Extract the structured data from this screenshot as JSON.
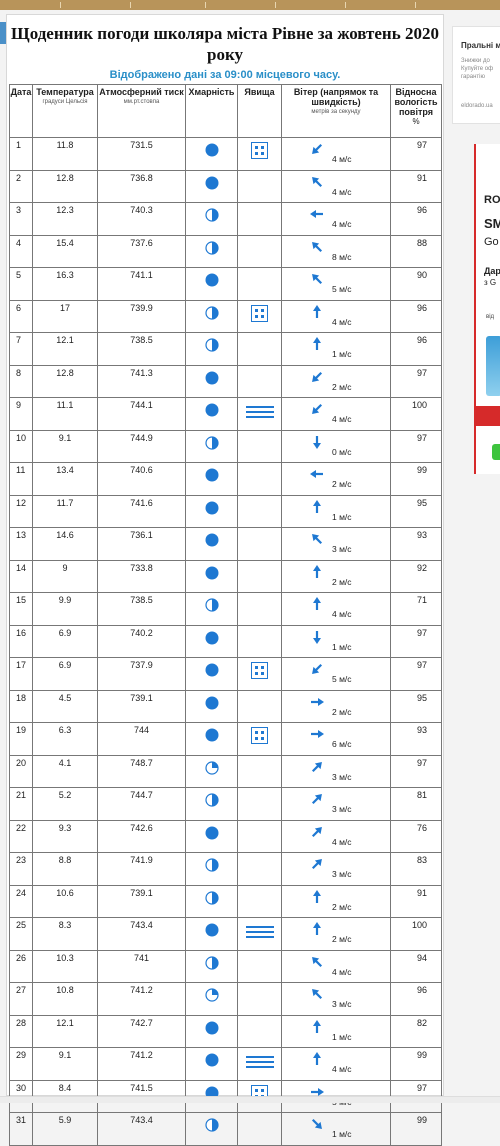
{
  "title": "Щоденник погоди школяра міста Рівне за жовтень 2020 року",
  "subtitle": "Відображено дані за 09:00 місцевого часу.",
  "headers": {
    "date": "Дата",
    "temp": "Температура",
    "temp_unit": "градуси Цельсія",
    "pressure": "Атмосферний тиск",
    "pressure_unit": "мм.рт.стовпа",
    "cloud": "Хмарність",
    "phenomena": "Явища",
    "wind": "Вітер (напрямок та швидкість)",
    "wind_unit": "метрів за секунду",
    "humidity": "Відносна вологість повітря",
    "humidity_unit": "%"
  },
  "rows": [
    {
      "date": "1",
      "temp": "11.8",
      "pressure": "731.5",
      "cloud": "full",
      "phen": "snow-grains",
      "dir": "sw",
      "speed": "4 м/с",
      "hum": "97"
    },
    {
      "date": "2",
      "temp": "12.8",
      "pressure": "736.8",
      "cloud": "full",
      "phen": "",
      "dir": "nw",
      "speed": "4 м/с",
      "hum": "91"
    },
    {
      "date": "3",
      "temp": "12.3",
      "pressure": "740.3",
      "cloud": "half",
      "phen": "",
      "dir": "w",
      "speed": "4 м/с",
      "hum": "96"
    },
    {
      "date": "4",
      "temp": "15.4",
      "pressure": "737.6",
      "cloud": "half",
      "phen": "",
      "dir": "nw",
      "speed": "8 м/с",
      "hum": "88"
    },
    {
      "date": "5",
      "temp": "16.3",
      "pressure": "741.1",
      "cloud": "full",
      "phen": "",
      "dir": "nw",
      "speed": "5 м/с",
      "hum": "90"
    },
    {
      "date": "6",
      "temp": "17",
      "pressure": "739.9",
      "cloud": "half",
      "phen": "snow-grains",
      "dir": "n",
      "speed": "4 м/с",
      "hum": "96"
    },
    {
      "date": "7",
      "temp": "12.1",
      "pressure": "738.5",
      "cloud": "half",
      "phen": "",
      "dir": "n",
      "speed": "1 м/с",
      "hum": "96"
    },
    {
      "date": "8",
      "temp": "12.8",
      "pressure": "741.3",
      "cloud": "full",
      "phen": "",
      "dir": "sw",
      "speed": "2 м/с",
      "hum": "97"
    },
    {
      "date": "9",
      "temp": "11.1",
      "pressure": "744.1",
      "cloud": "full",
      "phen": "fog",
      "dir": "sw",
      "speed": "4 м/с",
      "hum": "100"
    },
    {
      "date": "10",
      "temp": "9.1",
      "pressure": "744.9",
      "cloud": "half",
      "phen": "",
      "dir": "s",
      "speed": "0 м/с",
      "hum": "97"
    },
    {
      "date": "11",
      "temp": "13.4",
      "pressure": "740.6",
      "cloud": "full",
      "phen": "",
      "dir": "w",
      "speed": "2 м/с",
      "hum": "99"
    },
    {
      "date": "12",
      "temp": "11.7",
      "pressure": "741.6",
      "cloud": "full",
      "phen": "",
      "dir": "n",
      "speed": "1 м/с",
      "hum": "95"
    },
    {
      "date": "13",
      "temp": "14.6",
      "pressure": "736.1",
      "cloud": "full",
      "phen": "",
      "dir": "nw",
      "speed": "3 м/с",
      "hum": "93"
    },
    {
      "date": "14",
      "temp": "9",
      "pressure": "733.8",
      "cloud": "full",
      "phen": "",
      "dir": "n",
      "speed": "2 м/с",
      "hum": "92"
    },
    {
      "date": "15",
      "temp": "9.9",
      "pressure": "738.5",
      "cloud": "half",
      "phen": "",
      "dir": "n",
      "speed": "4 м/с",
      "hum": "71"
    },
    {
      "date": "16",
      "temp": "6.9",
      "pressure": "740.2",
      "cloud": "full",
      "phen": "",
      "dir": "s",
      "speed": "1 м/с",
      "hum": "97"
    },
    {
      "date": "17",
      "temp": "6.9",
      "pressure": "737.9",
      "cloud": "full",
      "phen": "snow-grains",
      "dir": "sw",
      "speed": "5 м/с",
      "hum": "97"
    },
    {
      "date": "18",
      "temp": "4.5",
      "pressure": "739.1",
      "cloud": "full",
      "phen": "",
      "dir": "e",
      "speed": "2 м/с",
      "hum": "95"
    },
    {
      "date": "19",
      "temp": "6.3",
      "pressure": "744",
      "cloud": "full",
      "phen": "snow-grains",
      "dir": "e",
      "speed": "6 м/с",
      "hum": "93"
    },
    {
      "date": "20",
      "temp": "4.1",
      "pressure": "748.7",
      "cloud": "quarter",
      "phen": "",
      "dir": "ne",
      "speed": "3 м/с",
      "hum": "97"
    },
    {
      "date": "21",
      "temp": "5.2",
      "pressure": "744.7",
      "cloud": "half",
      "phen": "",
      "dir": "ne",
      "speed": "3 м/с",
      "hum": "81"
    },
    {
      "date": "22",
      "temp": "9.3",
      "pressure": "742.6",
      "cloud": "full",
      "phen": "",
      "dir": "ne",
      "speed": "4 м/с",
      "hum": "76"
    },
    {
      "date": "23",
      "temp": "8.8",
      "pressure": "741.9",
      "cloud": "half",
      "phen": "",
      "dir": "ne",
      "speed": "3 м/с",
      "hum": "83"
    },
    {
      "date": "24",
      "temp": "10.6",
      "pressure": "739.1",
      "cloud": "half",
      "phen": "",
      "dir": "n",
      "speed": "2 м/с",
      "hum": "91"
    },
    {
      "date": "25",
      "temp": "8.3",
      "pressure": "743.4",
      "cloud": "full",
      "phen": "fog",
      "dir": "n",
      "speed": "2 м/с",
      "hum": "100"
    },
    {
      "date": "26",
      "temp": "10.3",
      "pressure": "741",
      "cloud": "half",
      "phen": "",
      "dir": "nw",
      "speed": "4 м/с",
      "hum": "94"
    },
    {
      "date": "27",
      "temp": "10.8",
      "pressure": "741.2",
      "cloud": "quarter",
      "phen": "",
      "dir": "nw",
      "speed": "3 м/с",
      "hum": "96"
    },
    {
      "date": "28",
      "temp": "12.1",
      "pressure": "742.7",
      "cloud": "full",
      "phen": "",
      "dir": "n",
      "speed": "1 м/с",
      "hum": "82"
    },
    {
      "date": "29",
      "temp": "9.1",
      "pressure": "741.2",
      "cloud": "full",
      "phen": "fog",
      "dir": "n",
      "speed": "4 м/с",
      "hum": "99"
    },
    {
      "date": "30",
      "temp": "8.4",
      "pressure": "741.5",
      "cloud": "full",
      "phen": "snow-grains",
      "dir": "e",
      "speed": "5 м/с",
      "hum": "97"
    },
    {
      "date": "31",
      "temp": "5.9",
      "pressure": "743.4",
      "cloud": "half",
      "phen": "",
      "dir": "se",
      "speed": "1 м/с",
      "hum": "99"
    }
  ],
  "colors": {
    "icon_blue": "#1e78d2",
    "subtitle": "#2a8fc8"
  },
  "sidebar_ad": {
    "heading": "Пральні м",
    "lines": "Знижки до\nКупуйте оф\nгарантію ",
    "source": "eldorado.ua"
  },
  "sidebar_ad2": {
    "l1": "RO",
    "l2": "SM",
    "l3": "Go",
    "l4": "Дар",
    "l5": "з G",
    "l6": "від"
  }
}
